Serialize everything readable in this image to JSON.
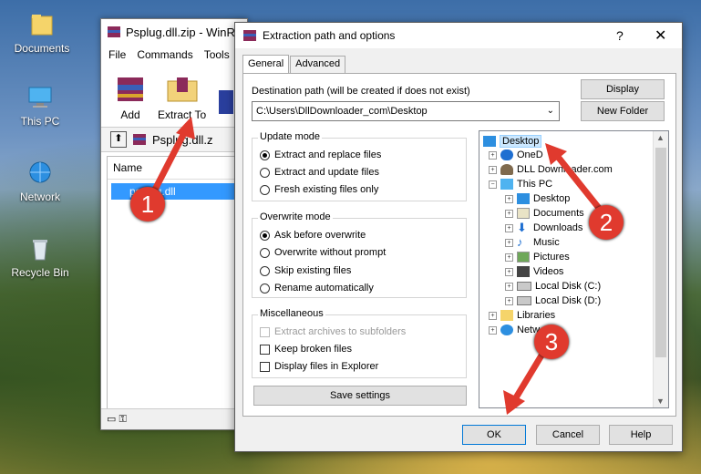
{
  "desktop": {
    "icons": [
      {
        "label": "Documents",
        "icon": "folder-icon"
      },
      {
        "label": "This PC",
        "icon": "computer-icon"
      },
      {
        "label": "Network",
        "icon": "network-icon"
      },
      {
        "label": "Recycle Bin",
        "icon": "recycle-bin-icon"
      }
    ]
  },
  "winrar": {
    "title": "Psplug.dll.zip - WinR",
    "menu": [
      "File",
      "Commands",
      "Tools"
    ],
    "tools": [
      {
        "label": "Add",
        "icon": "add-archive-icon"
      },
      {
        "label": "Extract To",
        "icon": "extract-to-icon"
      }
    ],
    "path": "Psplug.dll.z",
    "column_name": "Name",
    "file_row": "psplug.dll"
  },
  "dialog": {
    "title": "Extraction path and options",
    "help": "?",
    "close": "✕",
    "tabs": [
      "General",
      "Advanced"
    ],
    "dest_label": "Destination path (will be created if does not exist)",
    "dest_value": "C:\\Users\\DllDownloader_com\\Desktop",
    "display_btn": "Display",
    "new_folder_btn": "New Folder",
    "update_mode": {
      "title": "Update mode",
      "options": [
        "Extract and replace files",
        "Extract and update files",
        "Fresh existing files only"
      ],
      "selected": 0
    },
    "overwrite_mode": {
      "title": "Overwrite mode",
      "options": [
        "Ask before overwrite",
        "Overwrite without prompt",
        "Skip existing files",
        "Rename automatically"
      ],
      "selected": 0
    },
    "misc": {
      "title": "Miscellaneous",
      "options": [
        "Extract archives to subfolders",
        "Keep broken files",
        "Display files in Explorer"
      ]
    },
    "save_settings": "Save settings",
    "tree": [
      {
        "label": "Desktop",
        "level": 0,
        "selected": true,
        "icon": "desktop-icon"
      },
      {
        "label": "OneD",
        "level": 1,
        "icon": "onedrive-icon"
      },
      {
        "label": "DLL Downloader.com",
        "level": 1,
        "icon": "user-icon"
      },
      {
        "label": "This PC",
        "level": 1,
        "icon": "computer-icon"
      },
      {
        "label": "Desktop",
        "level": 2,
        "icon": "desktop-icon"
      },
      {
        "label": "Documents",
        "level": 2,
        "icon": "documents-icon"
      },
      {
        "label": "Downloads",
        "level": 2,
        "icon": "downloads-icon"
      },
      {
        "label": "Music",
        "level": 2,
        "icon": "music-icon"
      },
      {
        "label": "Pictures",
        "level": 2,
        "icon": "pictures-icon"
      },
      {
        "label": "Videos",
        "level": 2,
        "icon": "videos-icon"
      },
      {
        "label": "Local Disk (C:)",
        "level": 2,
        "icon": "drive-icon"
      },
      {
        "label": "Local Disk (D:)",
        "level": 2,
        "icon": "drive-icon"
      },
      {
        "label": "Libraries",
        "level": 1,
        "icon": "libraries-icon"
      },
      {
        "label": "Netw",
        "level": 1,
        "icon": "network-icon"
      }
    ],
    "ok": "OK",
    "cancel": "Cancel",
    "help_btn": "Help"
  },
  "callouts": [
    "1",
    "2",
    "3"
  ],
  "colors": {
    "callout": "#e03a2e",
    "selection": "#3399ff"
  }
}
